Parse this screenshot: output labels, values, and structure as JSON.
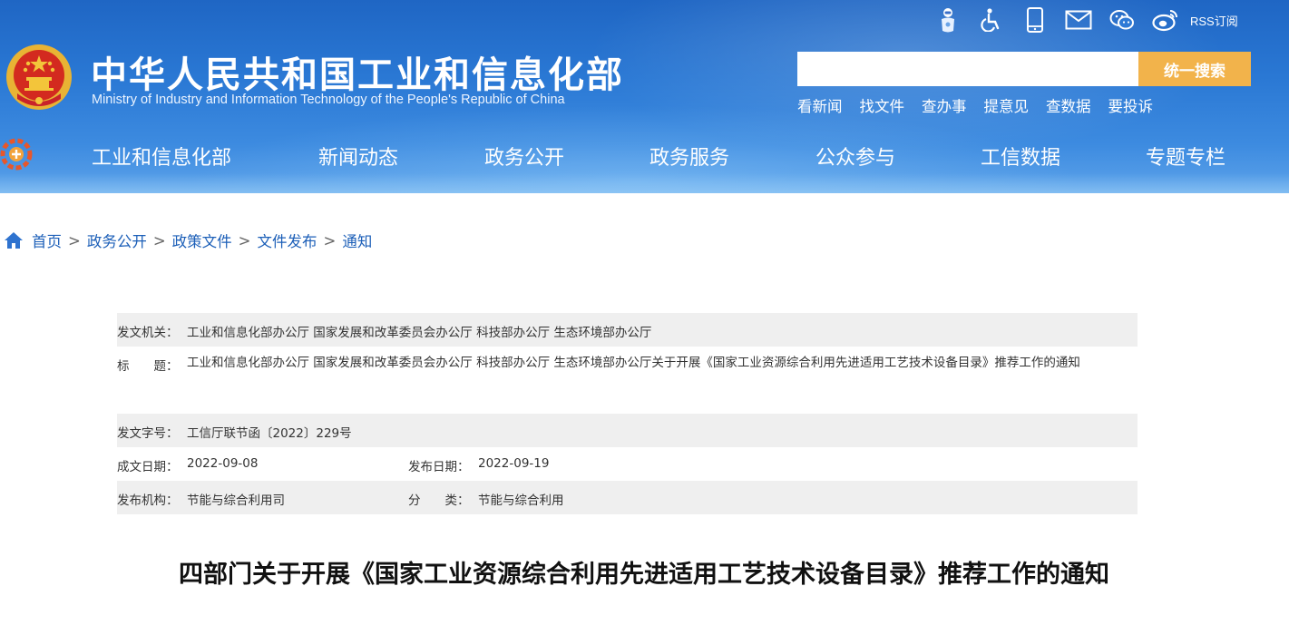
{
  "header": {
    "title_cn": "中华人民共和国工业和信息化部",
    "title_en": "Ministry of Industry and Information Technology of the People's Republic of China",
    "top_icons": [
      "robot-icon",
      "accessibility-icon",
      "mobile-icon",
      "mail-icon",
      "wechat-icon",
      "weibo-icon"
    ],
    "rss_label": "RSS订阅",
    "search": {
      "placeholder": "",
      "value": "",
      "button_label": "统一搜索"
    },
    "quick_links": [
      "看新闻",
      "找文件",
      "查办事",
      "提意见",
      "查数据",
      "要投诉"
    ],
    "nav": [
      "工业和信息化部",
      "新闻动态",
      "政务公开",
      "政务服务",
      "公众参与",
      "工信数据",
      "专题专栏"
    ],
    "colors": {
      "header_blue": "#2a78d4",
      "search_button": "#f2b34b"
    }
  },
  "breadcrumb": [
    "首页",
    "政务公开",
    "政策文件",
    "文件发布",
    "通知"
  ],
  "breadcrumb_separator": ">",
  "info": {
    "issuer_label": "发文机关：",
    "issuer": "工业和信息化部办公厅 国家发展和改革委员会办公厅 科技部办公厅 生态环境部办公厅",
    "title_label": "标　　题：",
    "title": "工业和信息化部办公厅 国家发展和改革委员会办公厅 科技部办公厅 生态环境部办公厅关于开展《国家工业资源综合利用先进适用工艺技术设备目录》推荐工作的通知",
    "doc_no_label": "发文字号：",
    "doc_no": "工信厅联节函〔2022〕229号",
    "created_label": "成文日期：",
    "created": "2022-09-08",
    "published_label": "发布日期：",
    "published": "2022-09-19",
    "org_label": "发布机构：",
    "org": "节能与综合利用司",
    "category_label": "分　　类：",
    "category": "节能与综合利用"
  },
  "article": {
    "title": "四部门关于开展《国家工业资源综合利用先进适用工艺技术设备目录》推荐工作的通知"
  }
}
